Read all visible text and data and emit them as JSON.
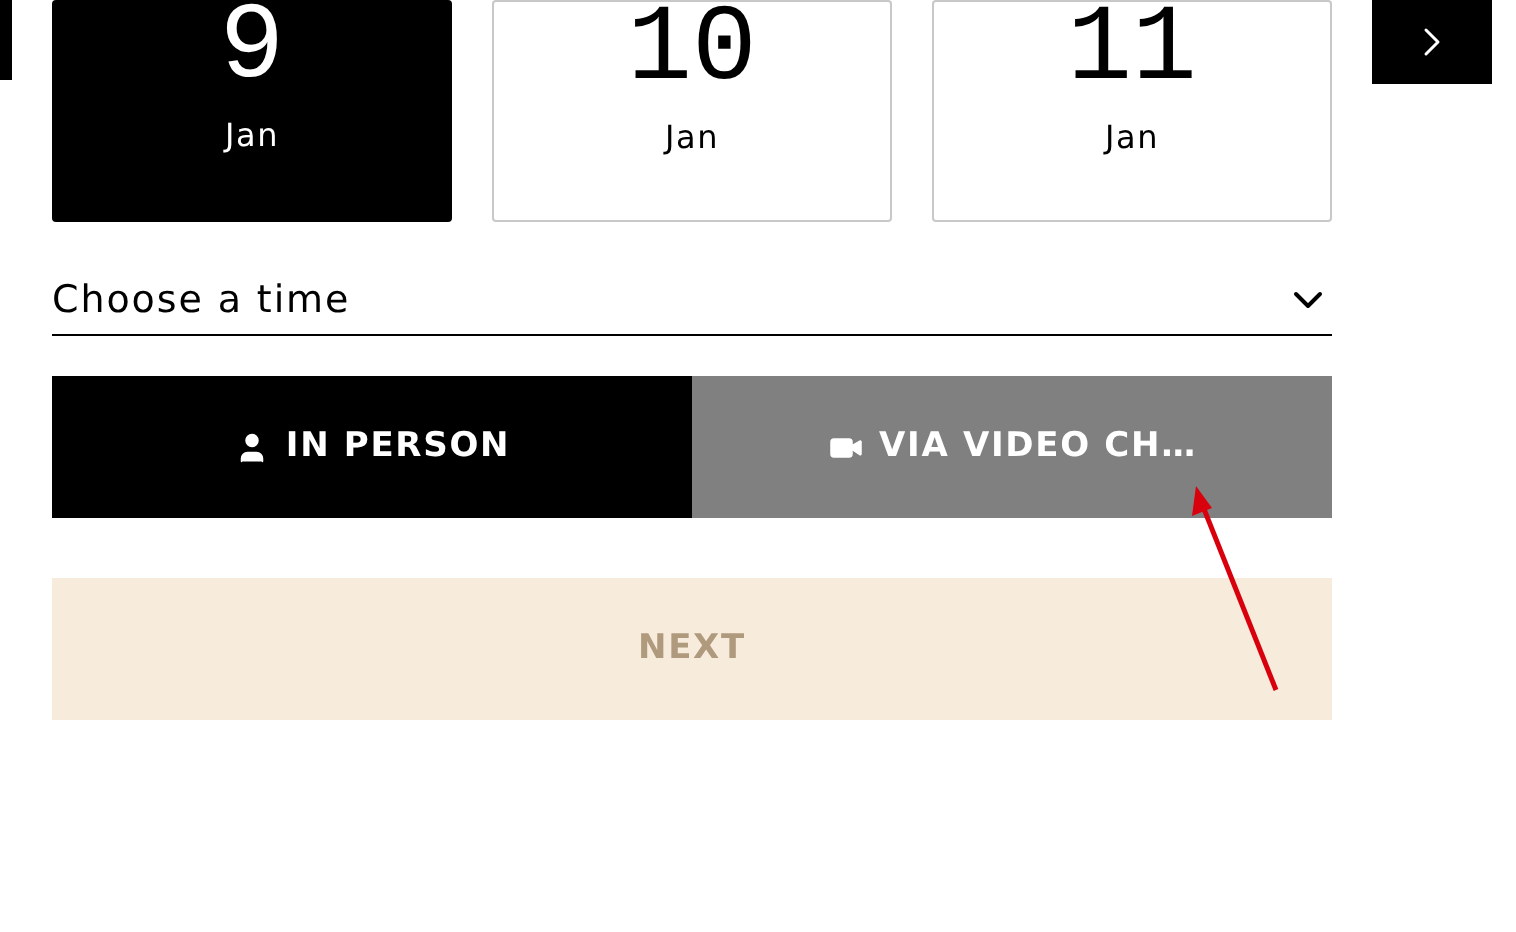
{
  "dates": [
    {
      "day": "9",
      "month": "Jan",
      "selected": true
    },
    {
      "day": "10",
      "month": "Jan",
      "selected": false
    },
    {
      "day": "11",
      "month": "Jan",
      "selected": false
    }
  ],
  "time_select": {
    "placeholder": "Choose a time"
  },
  "modes": [
    {
      "kind": "person",
      "label": "IN PERSON",
      "selected": true
    },
    {
      "kind": "video",
      "label": "VIA VIDEO CH…",
      "selected": false
    }
  ],
  "next_button": {
    "label": "NEXT",
    "disabled": true
  }
}
